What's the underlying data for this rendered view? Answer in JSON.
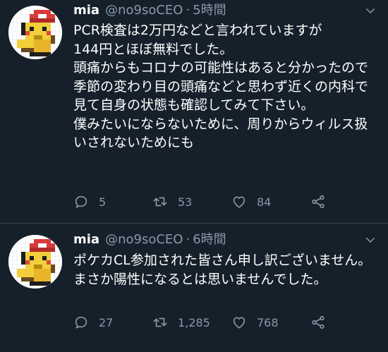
{
  "tweets": [
    {
      "name": "mia",
      "handle": "@no9soCEO",
      "separator": "·",
      "time": "5時間",
      "text": "PCR検査は2万円などと言われていますが\n144円とほぼ無料でした。\n頭痛からもコロナの可能性はあると分かったので季節の変わり目の頭痛などと思わず近くの内科で見て自身の状態も確認してみて下さい。\n僕みたいにならないために、周りからウィルス扱いされないためにも",
      "replies": "5",
      "retweets": "53",
      "likes": "84",
      "icons": [
        "reply-icon",
        "retweet-icon",
        "like-icon",
        "share-icon"
      ]
    },
    {
      "name": "mia",
      "handle": "@no9soCEO",
      "separator": "·",
      "time": "6時間",
      "text": "ポケカCL参加された皆さん申し訳ございません。\nまさか陽性になるとは思いませんでした。",
      "replies": "27",
      "retweets": "1,285",
      "likes": "768",
      "icons": [
        "reply-icon",
        "retweet-icon",
        "like-icon",
        "share-icon"
      ]
    }
  ],
  "colors": {
    "background": "#15202b",
    "text": "#ffffff",
    "secondary": "#8899a6",
    "divider": "#38444d"
  }
}
